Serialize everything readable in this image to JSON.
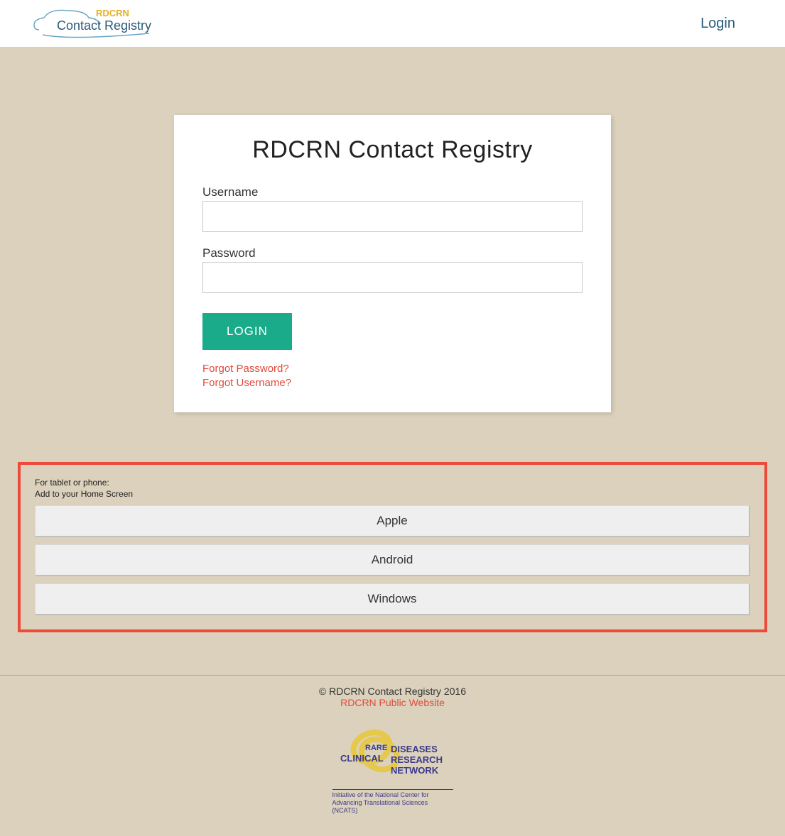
{
  "header": {
    "logo_line1": "RDCRN",
    "logo_line2": "Contact Registry",
    "login_link": "Login"
  },
  "login_card": {
    "title": "RDCRN Contact Registry",
    "username_label": "Username",
    "username_value": "",
    "password_label": "Password",
    "password_value": "",
    "login_button": "LOGIN",
    "forgot_password": "Forgot Password?",
    "forgot_username": "Forgot Username?"
  },
  "homescreen_box": {
    "line1": "For tablet or phone:",
    "line2": "Add to your Home Screen",
    "buttons": [
      "Apple",
      "Android",
      "Windows"
    ]
  },
  "footer": {
    "copyright": "© RDCRN Contact Registry 2016",
    "public_link": "RDCRN Public Website",
    "logo_word_rare": "RARE",
    "logo_word_diseases": "DISEASES",
    "logo_word_clinical": "CLINICAL",
    "logo_word_research": "RESEARCH",
    "logo_word_network": "NETWORK",
    "tagline": "Initiative of the National Center for Advancing Translational Sciences (NCATS)"
  }
}
